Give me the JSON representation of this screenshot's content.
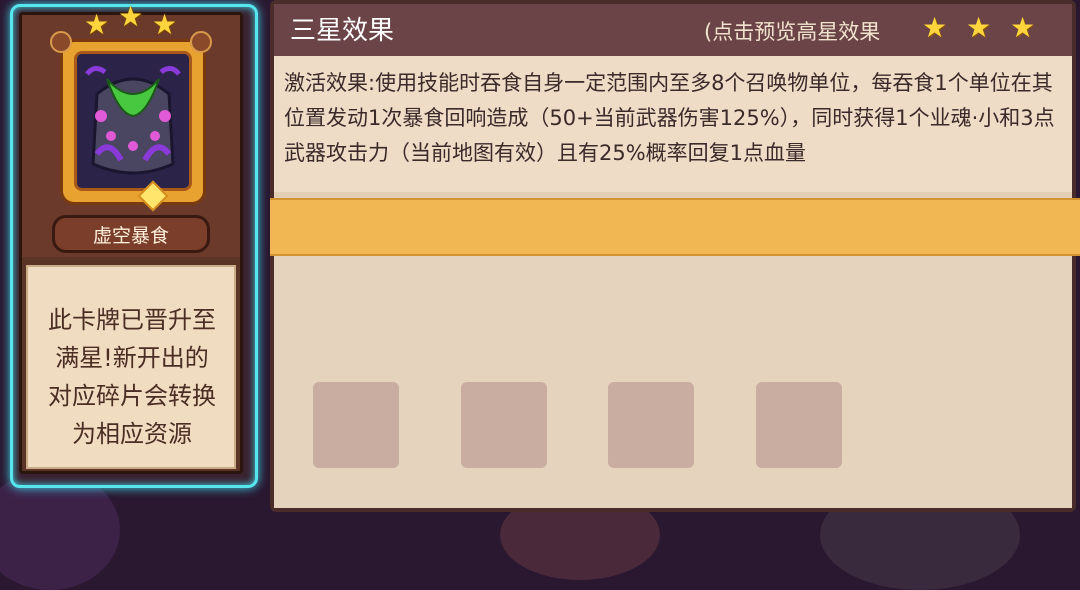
{
  "card": {
    "name": "虚空暴食",
    "star_count": 3,
    "message": [
      "此卡牌已晋升至",
      "满星!新开出的",
      "对应碎片会转换",
      "为相应资源"
    ]
  },
  "panel": {
    "title": "三星效果",
    "preview_hint": "(点击预览高星效果",
    "stars": [
      "★",
      "★",
      "★"
    ],
    "effect_text": "激活效果:使用技能时吞食自身一定范围内至多8个召唤物单位，每吞食1个单位在其位置发动1次暴食回响造成（50+当前武器伤害125%），同时获得1个业魂·小和3点武器攻击力（当前地图有效）且有25%概率回复1点血量",
    "slots": [
      "",
      "",
      "",
      ""
    ]
  },
  "colors": {
    "accent_glow": "#58e6ee",
    "star": "#ffd53d",
    "header": "#6b4448",
    "orange_bar": "#f0b752"
  }
}
